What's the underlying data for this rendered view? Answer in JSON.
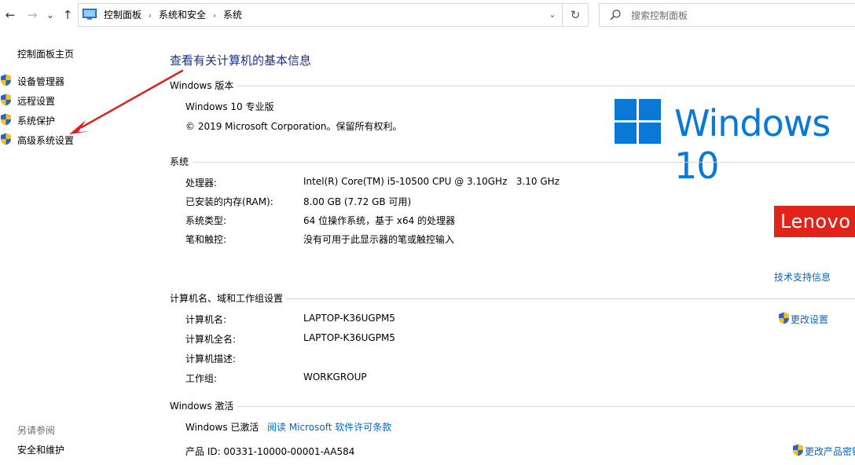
{
  "nav": {
    "back_icon": "←",
    "forward_icon": "→",
    "recent_icon": "⌄",
    "up_icon": "↑",
    "breadcrumbs": [
      "控制面板",
      "系统和安全",
      "系统"
    ],
    "dropdown_icon": "⌄",
    "refresh_icon": "↻",
    "search_placeholder": "搜索控制面板"
  },
  "sidebar": {
    "home": "控制面板主页",
    "items": [
      {
        "label": "设备管理器",
        "icon": "uac-shield-icon"
      },
      {
        "label": "远程设置",
        "icon": "uac-shield-icon"
      },
      {
        "label": "系统保护",
        "icon": "uac-shield-icon"
      },
      {
        "label": "高级系统设置",
        "icon": "uac-shield-icon"
      }
    ],
    "see_also": "另请参阅",
    "see_also_items": [
      "安全和维护"
    ]
  },
  "main": {
    "title": "查看有关计算机的基本信息",
    "edition": {
      "heading": "Windows 版本",
      "name": "Windows 10 专业版",
      "copyright": "© 2019 Microsoft Corporation。保留所有权利。",
      "logo_text": "Windows 10"
    },
    "system": {
      "heading": "系统",
      "rows": [
        {
          "label": "处理器:",
          "value": "Intel(R) Core(TM) i5-10500 CPU @ 3.10GHz   3.10 GHz"
        },
        {
          "label": "已安装的内存(RAM):",
          "value": "8.00 GB (7.72 GB 可用)"
        },
        {
          "label": "系统类型:",
          "value": "64 位操作系统，基于 x64 的处理器"
        },
        {
          "label": "笔和触控:",
          "value": "没有可用于此显示器的笔或触控输入"
        }
      ],
      "oem_logo": "Lenovo",
      "support_link": "技术支持信息"
    },
    "computer": {
      "heading": "计算机名、域和工作组设置",
      "rows": [
        {
          "label": "计算机名:",
          "value": "LAPTOP-K36UGPM5"
        },
        {
          "label": "计算机全名:",
          "value": "LAPTOP-K36UGPM5"
        },
        {
          "label": "计算机描述:",
          "value": ""
        },
        {
          "label": "工作组:",
          "value": "WORKGROUP"
        }
      ],
      "change_link": "更改设置"
    },
    "activation": {
      "heading": "Windows 激活",
      "status": "Windows 已激活",
      "license_link": "阅读 Microsoft 软件许可条款",
      "product_id": "产品 ID: 00331-10000-00001-AA584",
      "change_key_link": "更改产品密钥"
    }
  },
  "colors": {
    "link": "#0066cc",
    "title": "#1e3287",
    "windows_blue": "#0a78d7",
    "lenovo_red": "#e2231a",
    "annotation_arrow": "#e0201e"
  }
}
